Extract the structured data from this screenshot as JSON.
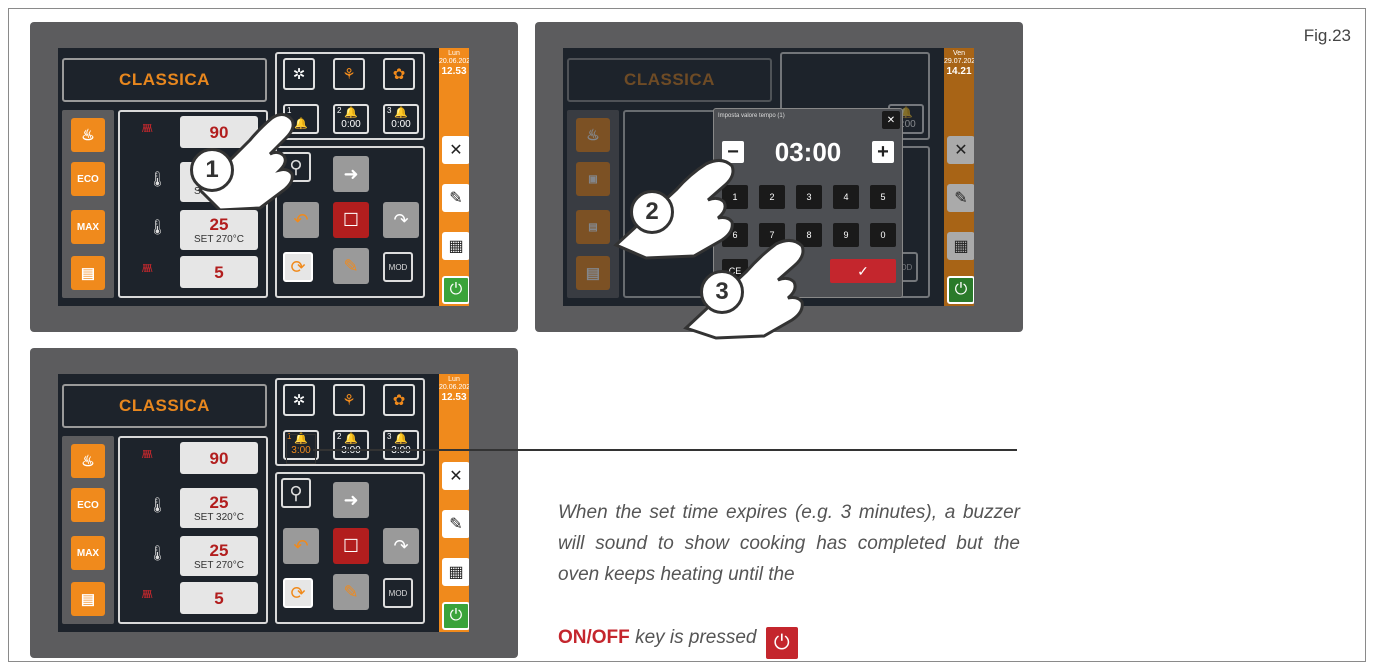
{
  "fig_label": "Fig.23",
  "screen1": {
    "title": "CLASSICA",
    "date_day": "Lun",
    "date": "20.06.2022",
    "time": "12.53",
    "val1": "90",
    "val2": "25",
    "val2_sub": "SET 320°C",
    "val3": "25",
    "val3_sub": "SET 270°C",
    "val4": "5",
    "timers": [
      {
        "num": "1",
        "value": ""
      },
      {
        "num": "2",
        "value": "0:00"
      },
      {
        "num": "3",
        "value": "0:00"
      }
    ],
    "mod_label": "MOD",
    "eco_label": "ECO",
    "max_label": "MAX",
    "step": "1"
  },
  "screen2": {
    "title": "CLASSICA",
    "date_day": "Ven",
    "date": "29.07.2022",
    "time": "14.21",
    "timer3": "3:00",
    "popup_title": "Imposta valore tempo (1)",
    "popup_value": "03:00",
    "keys": [
      "1",
      "2",
      "3",
      "4",
      "5",
      "6",
      "7",
      "8",
      "9",
      "0"
    ],
    "ce_label": "CE",
    "mod_label": "MOD",
    "step2": "2",
    "step3": "3"
  },
  "screen3": {
    "title": "CLASSICA",
    "date_day": "Lun",
    "date": "20.06.2022",
    "time": "12.53",
    "val1": "90",
    "val2": "25",
    "val2_sub": "SET 320°C",
    "val3": "25",
    "val3_sub": "SET 270°C",
    "val4": "5",
    "timers": [
      {
        "num": "1",
        "value": "3:00"
      },
      {
        "num": "2",
        "value": "3:00"
      },
      {
        "num": "3",
        "value": "3:00"
      }
    ],
    "mod_label": "MOD",
    "eco_label": "ECO",
    "max_label": "MAX"
  },
  "caption": {
    "text": "When the set time expires (e.g. 3 minutes), a buzzer will sound to show cooking has completed but the oven keeps heating until the",
    "onoff": "ON/OFF",
    "tail": "key is pressed"
  },
  "colors": {
    "orange": "#f08a1c",
    "red": "#c4262d",
    "green": "#3aa33a",
    "screen": "#1d232b"
  }
}
